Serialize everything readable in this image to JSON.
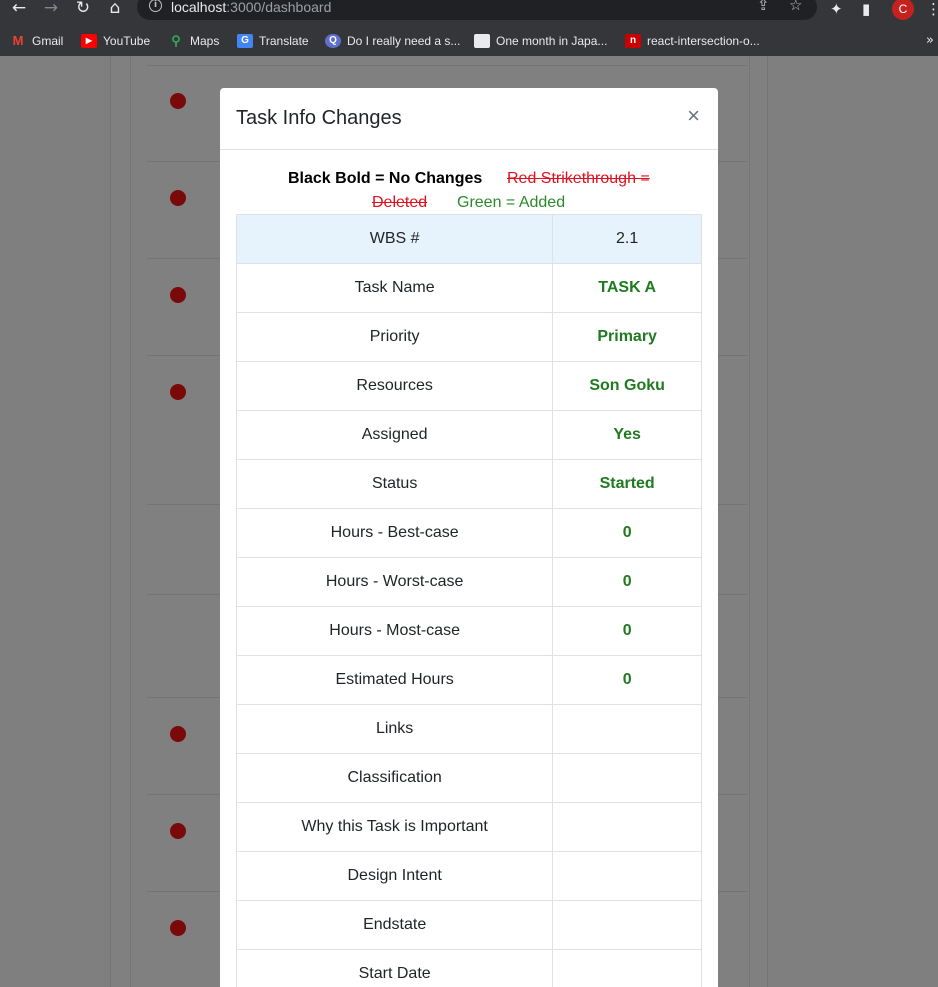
{
  "browser": {
    "url_host": "localhost",
    "url_rest": ":3000/dashboard",
    "avatar_letter": "C",
    "bookmarks": [
      {
        "label": "Gmail",
        "icon": "gmail-icon",
        "color": "#d93025"
      },
      {
        "label": "YouTube",
        "icon": "youtube-icon",
        "color": "#ff0000"
      },
      {
        "label": "Maps",
        "icon": "maps-icon",
        "color": "#34a853"
      },
      {
        "label": "Translate",
        "icon": "translate-icon",
        "color": "#4285f4"
      },
      {
        "label": "Do I really need a s...",
        "icon": "site-icon",
        "color": "#5f6fd0"
      },
      {
        "label": "One month in Japa...",
        "icon": "page-icon",
        "color": "#dadce0"
      },
      {
        "label": "react-intersection-o...",
        "icon": "npm-icon",
        "color": "#cb0000"
      }
    ]
  },
  "modal": {
    "title": "Task Info Changes",
    "close_label": "×",
    "legend": {
      "black": "Black Bold = No Changes",
      "red_line1": "Red Strikethrough =",
      "red_line2": "Deleted",
      "green": "Green = Added"
    },
    "rows": [
      {
        "label": "WBS #",
        "value": "2.1"
      },
      {
        "label": "Task Name",
        "value": "TASK A"
      },
      {
        "label": "Priority",
        "value": "Primary"
      },
      {
        "label": "Resources",
        "value": "Son Goku"
      },
      {
        "label": "Assigned",
        "value": "Yes"
      },
      {
        "label": "Status",
        "value": "Started"
      },
      {
        "label": "Hours - Best-case",
        "value": "0"
      },
      {
        "label": "Hours - Worst-case",
        "value": "0"
      },
      {
        "label": "Hours - Most-case",
        "value": "0"
      },
      {
        "label": "Estimated Hours",
        "value": "0"
      },
      {
        "label": "Links",
        "value": ""
      },
      {
        "label": "Classification",
        "value": ""
      },
      {
        "label": "Why this Task is Important",
        "value": ""
      },
      {
        "label": "Design Intent",
        "value": ""
      },
      {
        "label": "Endstate",
        "value": ""
      },
      {
        "label": "Start Date",
        "value": ""
      }
    ]
  },
  "colors": {
    "added": "#217a21",
    "deleted": "#e0101d",
    "header_row": "#e6f3fc",
    "status_dot": "#7a0a0a"
  }
}
